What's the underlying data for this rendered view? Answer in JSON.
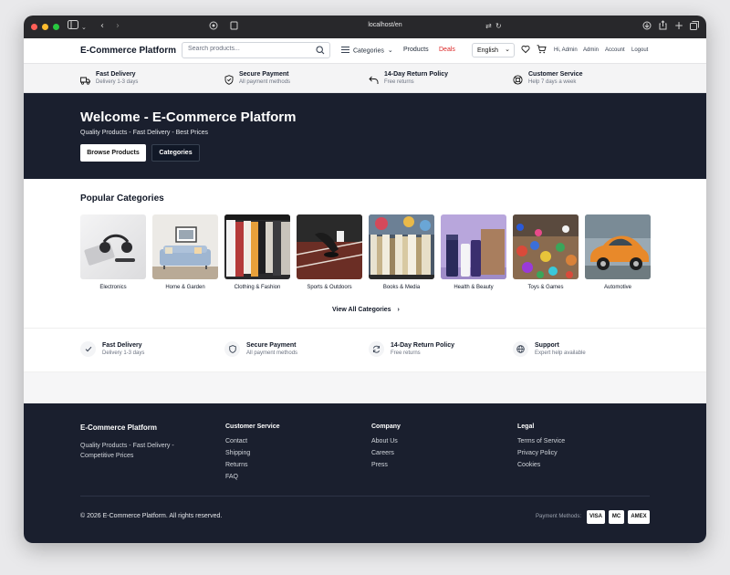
{
  "browser": {
    "url": "localhost/en"
  },
  "header": {
    "brand": "E-Commerce Platform",
    "search_placeholder": "Search products...",
    "search_value": "",
    "categories_label": "Categories",
    "products_label": "Products",
    "deals_label": "Deals",
    "language": "English",
    "greeting": "Hi, Admin",
    "admin_label": "Admin",
    "account_label": "Account",
    "logout_label": "Logout"
  },
  "features": [
    {
      "title": "Fast Delivery",
      "sub": "Delivery 1-3 days",
      "icon": "truck-icon"
    },
    {
      "title": "Secure Payment",
      "sub": "All payment methods",
      "icon": "shield-check-icon"
    },
    {
      "title": "14-Day Return Policy",
      "sub": "Free returns",
      "icon": "return-arrow-icon"
    },
    {
      "title": "Customer Service",
      "sub": "Help 7 days a week",
      "icon": "support-icon"
    }
  ],
  "hero": {
    "title": "Welcome - E-Commerce Platform",
    "subtitle": "Quality Products - Fast Delivery - Best Prices",
    "primary_button": "Browse Products",
    "secondary_button": "Categories"
  },
  "categories": {
    "heading": "Popular Categories",
    "items": [
      {
        "name": "Electronics"
      },
      {
        "name": "Home & Garden"
      },
      {
        "name": "Clothing & Fashion"
      },
      {
        "name": "Sports & Outdoors"
      },
      {
        "name": "Books & Media"
      },
      {
        "name": "Health & Beauty"
      },
      {
        "name": "Toys & Games"
      },
      {
        "name": "Automotive"
      }
    ],
    "view_all": "View All Categories"
  },
  "benefits": [
    {
      "title": "Fast Delivery",
      "sub": "Delivery 1-3 days",
      "icon": "check-icon"
    },
    {
      "title": "Secure Payment",
      "sub": "All payment methods",
      "icon": "shield-icon"
    },
    {
      "title": "14-Day Return Policy",
      "sub": "Free returns",
      "icon": "refresh-icon"
    },
    {
      "title": "Support",
      "sub": "Expert help available",
      "icon": "globe-icon"
    }
  ],
  "footer": {
    "brand": "E-Commerce Platform",
    "description": "Quality Products - Fast Delivery - Competitive Prices",
    "customer_service": {
      "heading": "Customer Service",
      "links": [
        "Contact",
        "Shipping",
        "Returns",
        "FAQ"
      ]
    },
    "company": {
      "heading": "Company",
      "links": [
        "About Us",
        "Careers",
        "Press"
      ]
    },
    "legal": {
      "heading": "Legal",
      "links": [
        "Terms of Service",
        "Privacy Policy",
        "Cookies"
      ]
    },
    "copyright": "© 2026 E-Commerce Platform. All rights reserved.",
    "payment_label": "Payment Methods:",
    "payment_methods": [
      "VISA",
      "MC",
      "AMEX"
    ]
  },
  "colors": {
    "dark": "#1a1f2e",
    "deals": "#dc2626",
    "accent_text": "#111827"
  }
}
